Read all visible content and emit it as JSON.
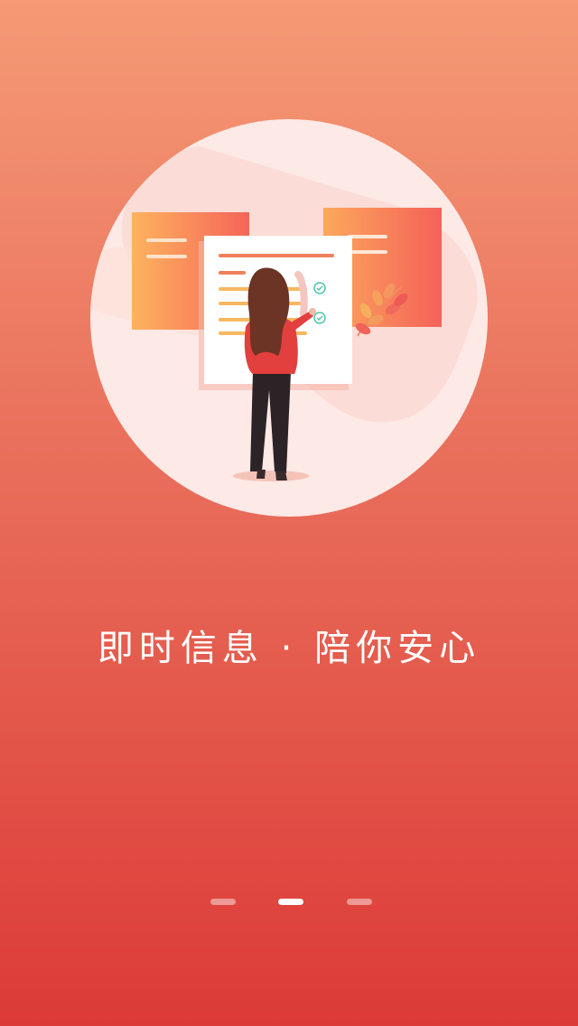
{
  "onboarding": {
    "tagline": "即时信息 · 陪你安心",
    "page_index": 2,
    "page_count": 3,
    "illustration": "woman-checking-documents-illustration"
  },
  "colors": {
    "background_top": "#f59a75",
    "background_bottom": "#dc3a37",
    "circle": "#fbe4e1",
    "active_dot": "#ffffff"
  }
}
